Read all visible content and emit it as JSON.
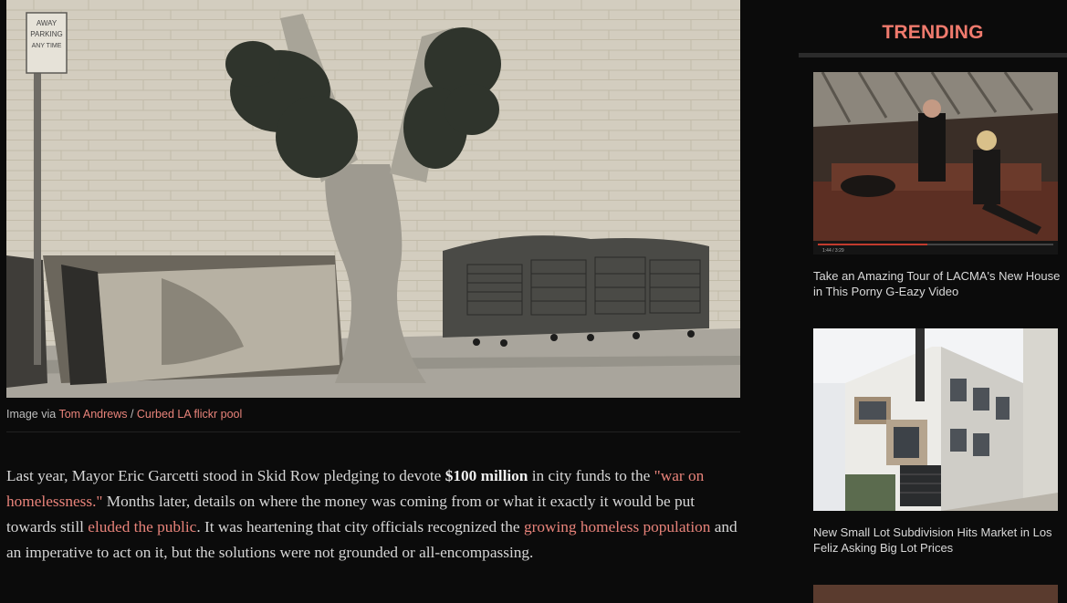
{
  "hero": {
    "caption_prefix": "Image via ",
    "credit_author": "Tom Andrews",
    "credit_sep": " / ",
    "credit_pool": "Curbed LA flickr pool",
    "sign_text_top": "AWAY",
    "sign_text_mid": "PARKING",
    "sign_text_bot": "ANY TIME"
  },
  "article": {
    "p1_a": "Last year, Mayor Eric Garcetti stood in Skid Row pledging to devote ",
    "p1_bold": "$100 million",
    "p1_b": " in city funds to the ",
    "p1_link1": "\"war on homelessness.\"",
    "p1_c": " Months later, details on where the money was coming from or what it exactly it would be put towards still ",
    "p1_link2": "eluded the public",
    "p1_d": ". It was heartening that city officials recognized the ",
    "p1_link3": "growing homeless population",
    "p1_e": " and an imperative to act on it, but the solutions were not grounded or all-encompassing."
  },
  "sidebar": {
    "title": "TRENDING",
    "cards": [
      {
        "title": "Take an Amazing Tour of LACMA's New House in This Porny G-Eazy Video",
        "video_time": "1:44 / 3:29"
      },
      {
        "title": "New Small Lot Subdivision Hits Market in Los Feliz Asking Big Lot Prices"
      }
    ]
  },
  "colors": {
    "background": "#0b0b0b",
    "accent": "#ef7a6d",
    "link": "#e8837a"
  }
}
